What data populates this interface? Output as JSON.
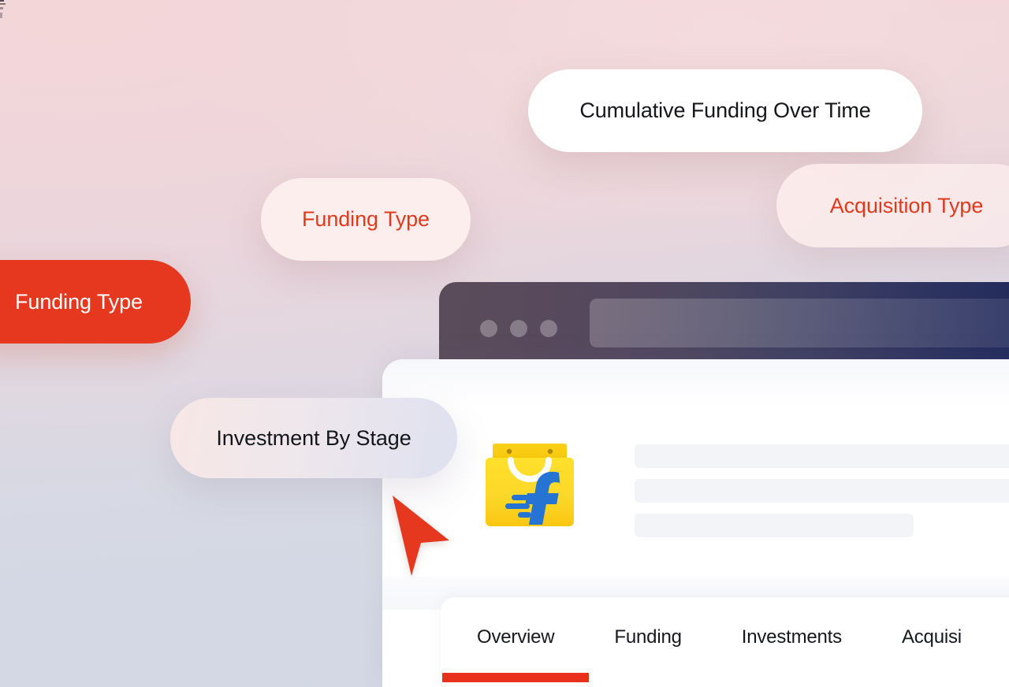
{
  "theme": {
    "accent_red": "#e5381f",
    "accent_red_text": "#e03a1d",
    "tab_underline": "#e8301d",
    "bg_top": "#f2d5d9",
    "bg_bottom": "#d3d8e4",
    "panel_white": "#ffffff",
    "skeleton_gray": "#f3f4f8",
    "chrome_left": "#5b4c5b",
    "chrome_right": "#20295a"
  },
  "pills": {
    "funding_type_solid": {
      "label": "Funding Type",
      "icon": "pill-chip"
    },
    "funding_type_light": {
      "label": "Funding Type",
      "icon": "pill-chip"
    },
    "cumulative_funding": {
      "label": "Cumulative Funding Over Time",
      "icon": "pill-chip"
    },
    "acquisition_type": {
      "label": "Acquisition Type",
      "icon": "pill-chip"
    },
    "investment_by_stage": {
      "label": "Investment By Stage",
      "icon": "pill-chip"
    }
  },
  "browser": {
    "traffic_lights": [
      "close-dot",
      "minimize-dot",
      "maximize-dot"
    ],
    "address_bar": {
      "value": "",
      "placeholder": ""
    }
  },
  "company": {
    "logo_name": "flipkart-logo",
    "skeleton_rows": 3
  },
  "tabs": [
    {
      "label": "Overview",
      "active": true
    },
    {
      "label": "Funding",
      "active": false
    },
    {
      "label": "Investments",
      "active": false
    },
    {
      "label": "Acquisi",
      "active": false
    }
  ],
  "cursor": {
    "icon": "arrow-pointer-cursor",
    "color": "#e5381f"
  }
}
